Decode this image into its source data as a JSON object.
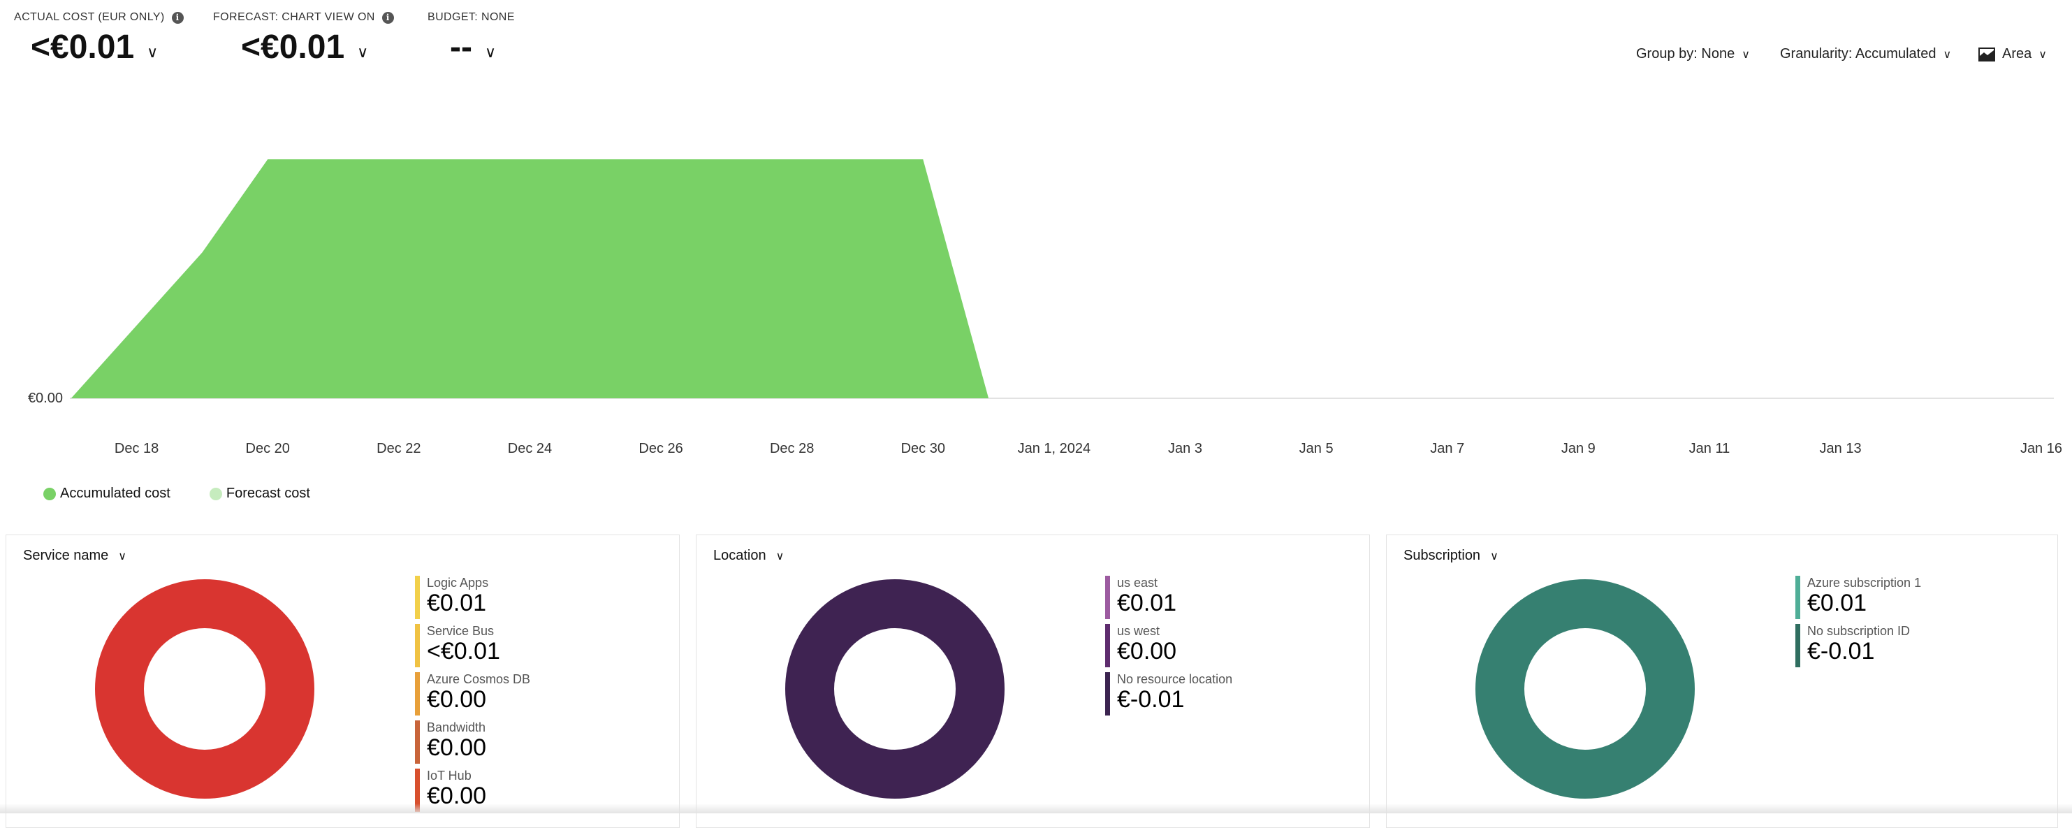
{
  "kpis": [
    {
      "label": "ACTUAL COST (EUR ONLY)",
      "value": "<€0.01"
    },
    {
      "label": "FORECAST: CHART VIEW ON",
      "value": "<€0.01"
    },
    {
      "label": "BUDGET: NONE",
      "value": "--"
    }
  ],
  "controls": {
    "group_by": "Group by: None",
    "granularity": "Granularity: Accumulated",
    "chart_type": "Area",
    "chart_type_icon": "area-chart-icon"
  },
  "chart_data": {
    "type": "area",
    "x_tick_labels": [
      "Dec 18",
      "Dec 20",
      "Dec 22",
      "Dec 24",
      "Dec 26",
      "Dec 28",
      "Dec 30",
      "Jan 1, 2024",
      "Jan 3",
      "Jan 5",
      "Jan 7",
      "Jan 9",
      "Jan 11",
      "Jan 13",
      "Jan 16"
    ],
    "y_tick_labels": [
      "€0.00"
    ],
    "series": [
      {
        "name": "Accumulated cost",
        "color": "#79d166",
        "points": [
          {
            "x": "2023-12-17",
            "y": 0.0
          },
          {
            "x": "2023-12-19",
            "y": 0.0061
          },
          {
            "x": "2023-12-20",
            "y": 0.01
          },
          {
            "x": "2023-12-30",
            "y": 0.01
          },
          {
            "x": "2023-12-31",
            "y": 0.0
          }
        ]
      },
      {
        "name": "Forecast cost",
        "color": "#c6ecbe",
        "points": []
      }
    ],
    "x_range": [
      "2023-12-16",
      "2024-01-16"
    ],
    "ylim": [
      0,
      0.01
    ],
    "grid": false,
    "legend_position": "bottom-left"
  },
  "legend": [
    {
      "label": "Accumulated cost",
      "color": "#79d166"
    },
    {
      "label": "Forecast cost",
      "color": "#c6ecbe"
    }
  ],
  "panels": [
    {
      "title": "Service name",
      "donut_color": "#d93530",
      "items": [
        {
          "name": "Logic Apps",
          "value": "€0.01",
          "color": "#f2d04a"
        },
        {
          "name": "Service Bus",
          "value": "<€0.01",
          "color": "#f0c243"
        },
        {
          "name": "Azure Cosmos DB",
          "value": "€0.00",
          "color": "#e8a03a"
        },
        {
          "name": "Bandwidth",
          "value": "€0.00",
          "color": "#c8643a"
        },
        {
          "name": "IoT Hub",
          "value": "€0.00",
          "color": "#d8502e"
        }
      ]
    },
    {
      "title": "Location",
      "donut_color": "#3f2352",
      "items": [
        {
          "name": "us east",
          "value": "€0.01",
          "color": "#9c5ba0"
        },
        {
          "name": "us west",
          "value": "€0.00",
          "color": "#5e2c6e"
        },
        {
          "name": "No resource location",
          "value": "€-0.01",
          "color": "#3b2450"
        }
      ]
    },
    {
      "title": "Subscription",
      "donut_color": "#368071",
      "items": [
        {
          "name": "Azure subscription 1",
          "value": "€0.01",
          "color": "#4fae97"
        },
        {
          "name": "No subscription ID",
          "value": "€-0.01",
          "color": "#2f6e60"
        }
      ]
    }
  ]
}
